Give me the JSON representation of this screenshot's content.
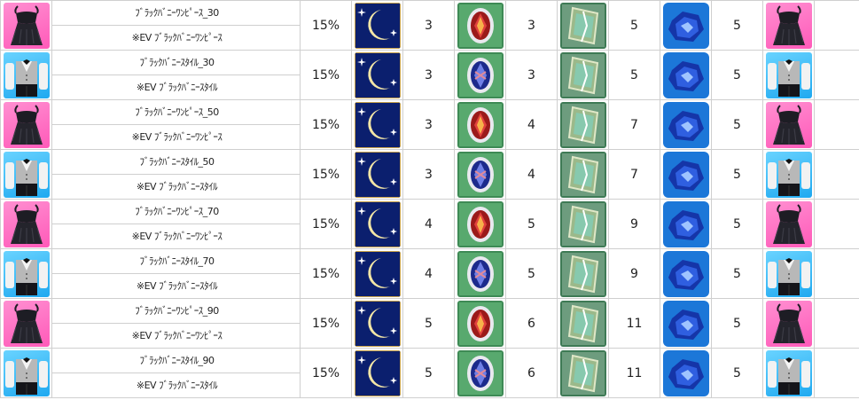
{
  "rows": [
    {
      "name": "ﾌﾞﾗｯｸﾊﾞﾆｰﾜﾝﾋﾟｰｽ_30",
      "sub": "※EV ﾌﾞﾗｯｸﾊﾞﾆｰﾜﾝﾋﾟｰｽ",
      "type": "dress",
      "rate": "15%",
      "moon": "3",
      "gem": "3",
      "card": "5",
      "ore": "5"
    },
    {
      "name": "ﾌﾞﾗｯｸﾊﾞﾆｰｽﾀｲﾙ_30",
      "sub": "※EV ﾌﾞﾗｯｸﾊﾞﾆｰｽﾀｲﾙ",
      "type": "suit",
      "rate": "15%",
      "moon": "3",
      "gem": "3",
      "card": "5",
      "ore": "5"
    },
    {
      "name": "ﾌﾞﾗｯｸﾊﾞﾆｰﾜﾝﾋﾟｰｽ_50",
      "sub": "※EV ﾌﾞﾗｯｸﾊﾞﾆｰﾜﾝﾋﾟｰｽ",
      "type": "dress",
      "rate": "15%",
      "moon": "3",
      "gem": "4",
      "card": "7",
      "ore": "5"
    },
    {
      "name": "ﾌﾞﾗｯｸﾊﾞﾆｰｽﾀｲﾙ_50",
      "sub": "※EV ﾌﾞﾗｯｸﾊﾞﾆｰｽﾀｲﾙ",
      "type": "suit",
      "rate": "15%",
      "moon": "3",
      "gem": "4",
      "card": "7",
      "ore": "5"
    },
    {
      "name": "ﾌﾞﾗｯｸﾊﾞﾆｰﾜﾝﾋﾟｰｽ_70",
      "sub": "※EV ﾌﾞﾗｯｸﾊﾞﾆｰﾜﾝﾋﾟｰｽ",
      "type": "dress",
      "rate": "15%",
      "moon": "4",
      "gem": "5",
      "card": "9",
      "ore": "5"
    },
    {
      "name": "ﾌﾞﾗｯｸﾊﾞﾆｰｽﾀｲﾙ_70",
      "sub": "※EV ﾌﾞﾗｯｸﾊﾞﾆｰｽﾀｲﾙ",
      "type": "suit",
      "rate": "15%",
      "moon": "4",
      "gem": "5",
      "card": "9",
      "ore": "5"
    },
    {
      "name": "ﾌﾞﾗｯｸﾊﾞﾆｰﾜﾝﾋﾟｰｽ_90",
      "sub": "※EV ﾌﾞﾗｯｸﾊﾞﾆｰﾜﾝﾋﾟｰｽ",
      "type": "dress",
      "rate": "15%",
      "moon": "5",
      "gem": "6",
      "card": "11",
      "ore": "5"
    },
    {
      "name": "ﾌﾞﾗｯｸﾊﾞﾆｰｽﾀｲﾙ_90",
      "sub": "※EV ﾌﾞﾗｯｸﾊﾞﾆｰｽﾀｲﾙ",
      "type": "suit",
      "rate": "15%",
      "moon": "5",
      "gem": "6",
      "card": "11",
      "ore": "5"
    }
  ],
  "icons": {
    "dress": "black-dress-icon",
    "suit": "bunny-suit-icon",
    "moon": "crescent-moon-icon",
    "red_gem": "red-gem-icon",
    "blue_gem": "blue-gem-icon",
    "card": "green-card-icon",
    "ore": "blue-ore-icon"
  },
  "colors": {
    "pink_bg": "#ff6fc4",
    "blue_bg": "#3dbdf5",
    "moon_bg": "#0a1a5a",
    "gem_frame": "#a3d9a0",
    "border": "#cfcfcf"
  }
}
